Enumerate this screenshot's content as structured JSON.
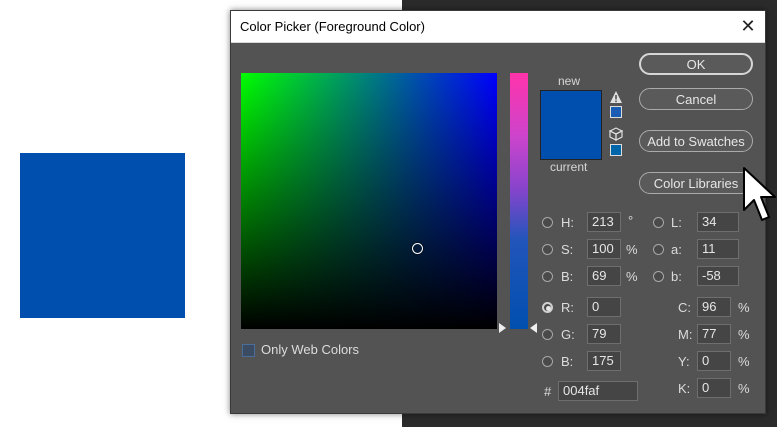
{
  "dialog": {
    "title": "Color Picker (Foreground Color)",
    "close_glyph": "✕"
  },
  "colors": {
    "selected": "#004faf",
    "dialog_bg": "#535353"
  },
  "preview": {
    "new_label": "new",
    "current_label": "current"
  },
  "icons": {
    "gamut_warning": "warning-triangle-icon",
    "web_safe": "cube-icon"
  },
  "buttons": {
    "ok": "OK",
    "cancel": "Cancel",
    "add_to_swatches": "Add to Swatches",
    "color_libraries": "Color Libraries"
  },
  "hsb": {
    "h": {
      "label": "H:",
      "value": "213",
      "unit": "°"
    },
    "s": {
      "label": "S:",
      "value": "100",
      "unit": "%"
    },
    "b": {
      "label": "B:",
      "value": "69",
      "unit": "%"
    }
  },
  "lab": {
    "l": {
      "label": "L:",
      "value": "34"
    },
    "a": {
      "label": "a:",
      "value": "11"
    },
    "b": {
      "label": "b:",
      "value": "-58"
    }
  },
  "rgb": {
    "r": {
      "label": "R:",
      "value": "0"
    },
    "g": {
      "label": "G:",
      "value": "79"
    },
    "b": {
      "label": "B:",
      "value": "175"
    }
  },
  "cmyk": {
    "c": {
      "label": "C:",
      "value": "96",
      "unit": "%"
    },
    "m": {
      "label": "M:",
      "value": "77",
      "unit": "%"
    },
    "y": {
      "label": "Y:",
      "value": "0",
      "unit": "%"
    },
    "k": {
      "label": "K:",
      "value": "0",
      "unit": "%"
    }
  },
  "hex": {
    "label": "#",
    "value": "004faf"
  },
  "web_colors": {
    "label": "Only Web Colors",
    "checked": false
  }
}
